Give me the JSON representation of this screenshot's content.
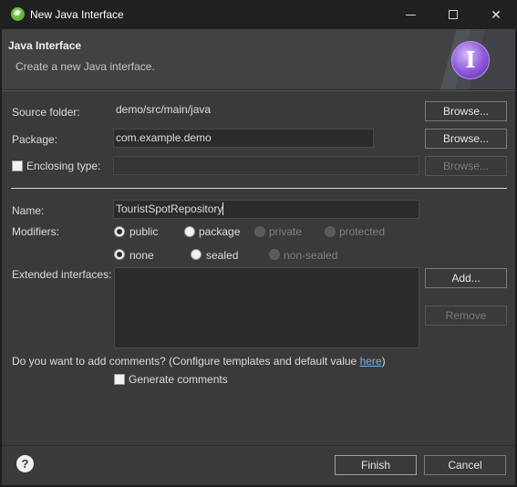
{
  "window": {
    "title": "New Java Interface",
    "minimize_icon": "minimize-icon",
    "maximize_icon": "maximize-icon",
    "close_glyph": "✕"
  },
  "header": {
    "title": "Java Interface",
    "description": "Create a new Java interface.",
    "icon_letter": "I"
  },
  "form": {
    "source_folder": {
      "label": "Source folder:",
      "value": "demo/src/main/java",
      "browse": "Browse..."
    },
    "package": {
      "label": "Package:",
      "value": "com.example.demo",
      "browse": "Browse..."
    },
    "enclosing_type": {
      "label": "Enclosing type:",
      "value": "",
      "browse": "Browse...",
      "checked": false
    },
    "name": {
      "label": "Name:",
      "value": "TouristSpotRepository"
    },
    "modifiers": {
      "label": "Modifiers:",
      "row1": [
        "public",
        "package",
        "private",
        "protected"
      ],
      "row2": [
        "none",
        "sealed",
        "non-sealed"
      ],
      "selected": [
        "public",
        "none"
      ]
    },
    "extended_interfaces": {
      "label": "Extended interfaces:",
      "add": "Add...",
      "remove": "Remove"
    },
    "comments": {
      "question": "Do you want to add comments? (Configure templates and default value ",
      "link": "here",
      "close_paren": ")",
      "generate_label": "Generate comments",
      "checked": false
    }
  },
  "footer": {
    "help_glyph": "?",
    "finish": "Finish",
    "cancel": "Cancel"
  }
}
